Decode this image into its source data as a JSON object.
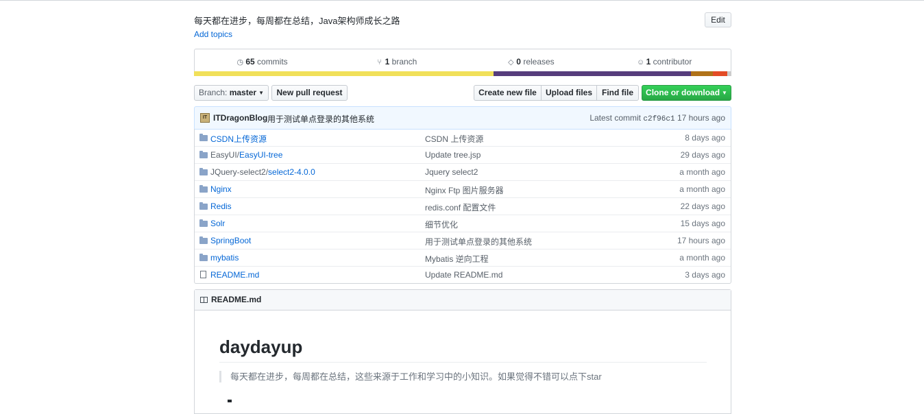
{
  "repo": {
    "description": "每天都在进步，每周都在总结，Java架构师成长之路",
    "edit_label": "Edit",
    "add_topics_label": "Add topics"
  },
  "summary": {
    "commits_count": "65",
    "commits_label": "commits",
    "branch_count": "1",
    "branch_label": "branch",
    "releases_count": "0",
    "releases_label": "releases",
    "contributor_count": "1",
    "contributor_label": "contributor"
  },
  "language_bar": [
    {
      "color": "#f1e05a",
      "percent": 55.8
    },
    {
      "color": "#563d7c",
      "percent": 36.7
    },
    {
      "color": "#b07219",
      "percent": 4.1
    },
    {
      "color": "#e34c26",
      "percent": 2.6
    },
    {
      "color": "#cccccc",
      "percent": 0.8
    }
  ],
  "filenav": {
    "branch_prefix": "Branch:",
    "branch_name": "master",
    "new_pull_request": "New pull request",
    "create_new_file": "Create new file",
    "upload_files": "Upload files",
    "find_file": "Find file",
    "clone_or_download": "Clone or download"
  },
  "latest_commit": {
    "avatar_text": "IT",
    "author": "ITDragonBlog",
    "message": "用于测试单点登录的其他系统",
    "prefix": "Latest commit",
    "sha": "c2f96c1",
    "age": "17 hours ago"
  },
  "files": [
    {
      "type": "dir",
      "prefix": "",
      "name": "CSDN上传资源",
      "message": "CSDN 上传资源",
      "age": "8 days ago"
    },
    {
      "type": "dir",
      "prefix": "EasyUI/",
      "name": "EasyUI-tree",
      "message": "Update tree.jsp",
      "age": "29 days ago"
    },
    {
      "type": "dir",
      "prefix": "JQuery-select2/",
      "name": "select2-4.0.0",
      "message": "Jquery select2",
      "age": "a month ago"
    },
    {
      "type": "dir",
      "prefix": "",
      "name": "Nginx",
      "message": "Nginx Ftp 图片服务器",
      "age": "a month ago"
    },
    {
      "type": "dir",
      "prefix": "",
      "name": "Redis",
      "message": "redis.conf 配置文件",
      "age": "22 days ago"
    },
    {
      "type": "dir",
      "prefix": "",
      "name": "Solr",
      "message": "细节优化",
      "age": "15 days ago"
    },
    {
      "type": "dir",
      "prefix": "",
      "name": "SpringBoot",
      "message": "用于测试单点登录的其他系统",
      "age": "17 hours ago"
    },
    {
      "type": "dir",
      "prefix": "",
      "name": "mybatis",
      "message": "Mybatis 逆向工程",
      "age": "a month ago"
    },
    {
      "type": "file",
      "prefix": "",
      "name": "README.md",
      "message": "Update README.md",
      "age": "3 days ago"
    }
  ],
  "readme": {
    "header_title": "README.md",
    "h1": "daydayup",
    "quote": "每天都在进步，每周都在总结，这些来源于工作和学习中的小知识。如果觉得不错可以点下star"
  }
}
